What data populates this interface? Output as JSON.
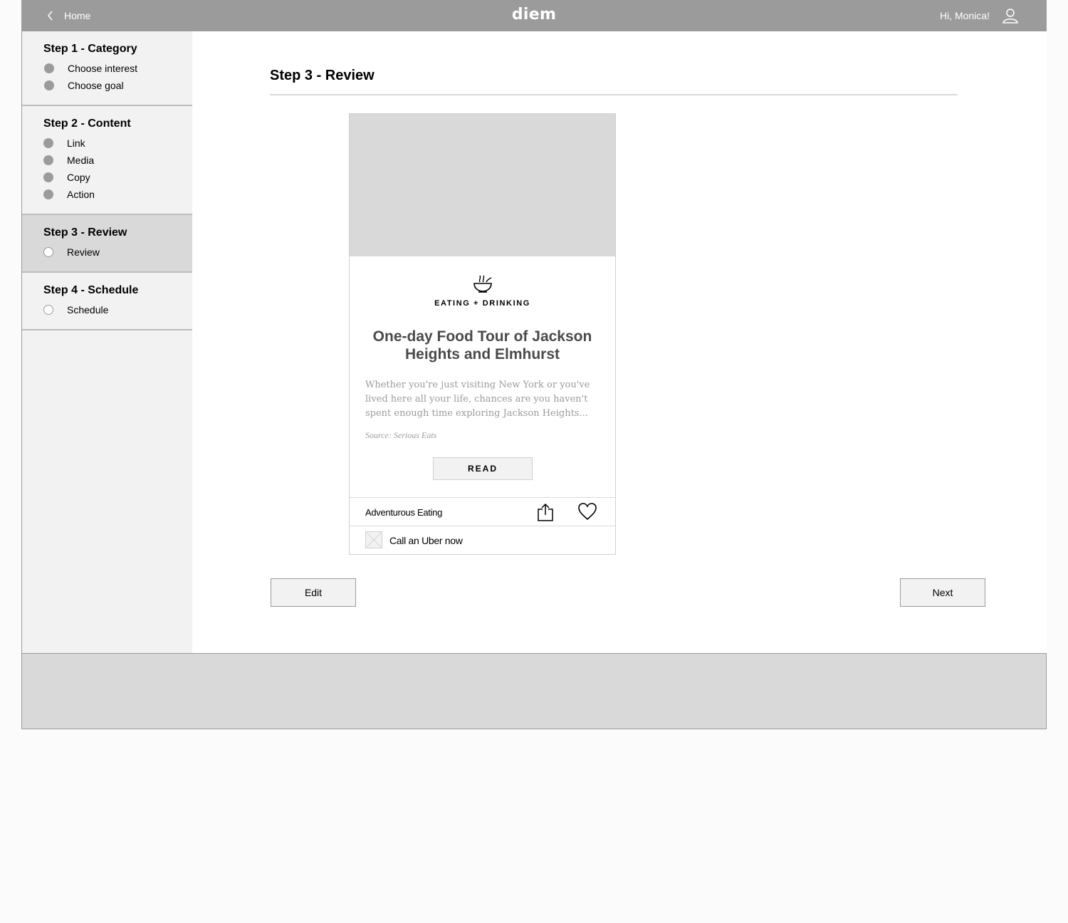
{
  "header": {
    "back_label": "Home",
    "logo": "diem",
    "greeting": "Hi, Monica!"
  },
  "sidebar": {
    "steps": [
      {
        "title": "Step 1 - Category",
        "items": [
          {
            "label": "Choose interest",
            "done": true
          },
          {
            "label": "Choose goal",
            "done": true
          }
        ]
      },
      {
        "title": "Step 2 - Content",
        "items": [
          {
            "label": "Link",
            "done": true
          },
          {
            "label": "Media",
            "done": true
          },
          {
            "label": "Copy",
            "done": true
          },
          {
            "label": "Action",
            "done": true
          }
        ]
      },
      {
        "title": "Step 3 - Review",
        "active": true,
        "items": [
          {
            "label": "Review",
            "done": false
          }
        ]
      },
      {
        "title": "Step 4 - Schedule",
        "items": [
          {
            "label": "Schedule",
            "done": false
          }
        ]
      }
    ]
  },
  "main": {
    "title": "Step 3 - Review",
    "card": {
      "category_icon": "bowl-icon",
      "category": "EATING + DRINKING",
      "title": "One-day Food Tour of Jackson Heights and Elmhurst",
      "description": "Whether you're just visiting New York or you've lived here all your life, chances are you haven't spent enough time exploring Jackson Heights...",
      "source": "Source: Serious Eats",
      "read_label": "READ",
      "tag": "Adventurous Eating",
      "action_label": "Call an Uber now"
    },
    "edit_label": "Edit",
    "next_label": "Next"
  },
  "colors": {
    "header_bg": "#9b9b9b",
    "sidebar_bg": "#f2f2f2",
    "active_step_bg": "#d9d9d9",
    "footer_bg": "#d9d9d9"
  }
}
